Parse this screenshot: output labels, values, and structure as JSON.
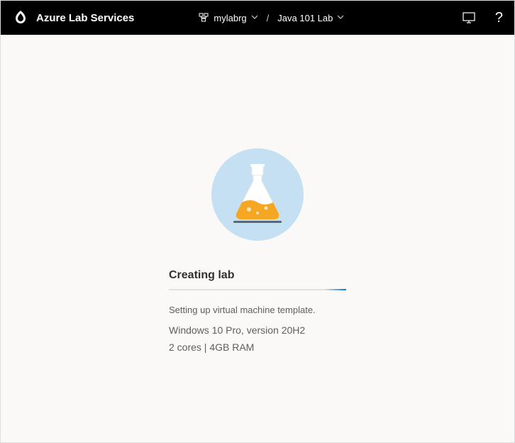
{
  "header": {
    "product_name": "Azure Lab Services",
    "breadcrumb": {
      "account": "mylabrg",
      "lab": "Java 101 Lab"
    }
  },
  "status": {
    "title": "Creating lab",
    "message": "Setting up virtual machine template.",
    "os": "Windows 10 Pro, version 20H2",
    "specs": "2 cores | 4GB RAM"
  }
}
